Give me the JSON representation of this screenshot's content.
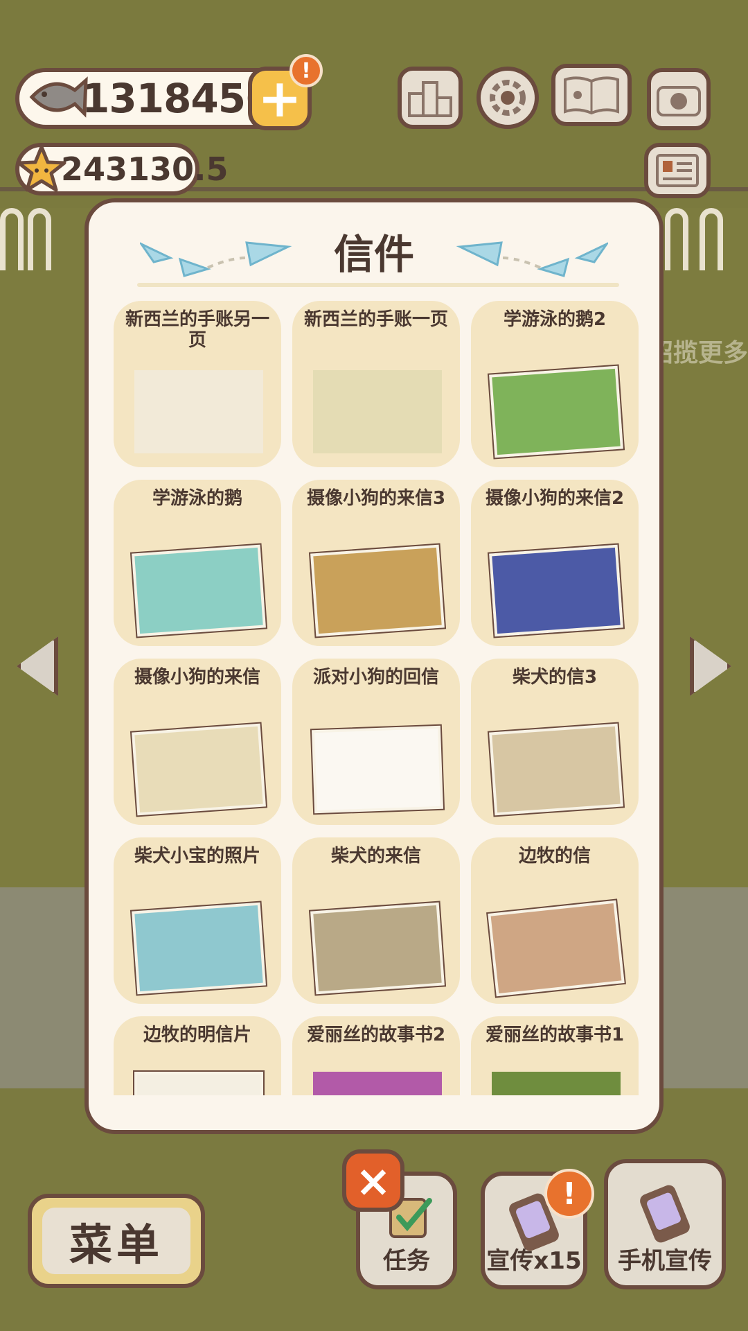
{
  "currency": {
    "fish_value": "13184566",
    "star_value": "243130.5"
  },
  "alerts": {
    "plus_badge": "!",
    "promo_badge": "!"
  },
  "background": {
    "side_text": "招揽更多"
  },
  "panel": {
    "title": "信件",
    "letters": [
      {
        "title": "新西兰的手账另一页"
      },
      {
        "title": "新西兰的手账一页"
      },
      {
        "title": "学游泳的鹅2"
      },
      {
        "title": "学游泳的鹅"
      },
      {
        "title": "摄像小狗的来信3"
      },
      {
        "title": "摄像小狗的来信2"
      },
      {
        "title": "摄像小狗的来信"
      },
      {
        "title": "派对小狗的回信"
      },
      {
        "title": "柴犬的信3"
      },
      {
        "title": "柴犬小宝的照片"
      },
      {
        "title": "柴犬的来信"
      },
      {
        "title": "边牧的信"
      },
      {
        "title": "边牧的明信片"
      },
      {
        "title": "爱丽丝的故事书2"
      },
      {
        "title": "爱丽丝的故事书1"
      }
    ]
  },
  "bottom_bar": {
    "close": "×",
    "menu": "菜单",
    "tasks": "任务",
    "promo": "宣传x15",
    "phone_promo": "手机宣传"
  },
  "icons": {
    "top_bar": [
      "ranking-icon",
      "settings-gear-icon",
      "paw-book-icon",
      "camera-icon",
      "newspaper-icon"
    ],
    "arrows": [
      "arrow-left-icon",
      "arrow-right-icon"
    ]
  },
  "colors": {
    "panel_bg": "#fbf5ec",
    "card_bg": "#f4e5c2",
    "outline": "#6b4b3e",
    "accent_orange": "#e2602a",
    "accent_yellow": "#f5c04a"
  }
}
